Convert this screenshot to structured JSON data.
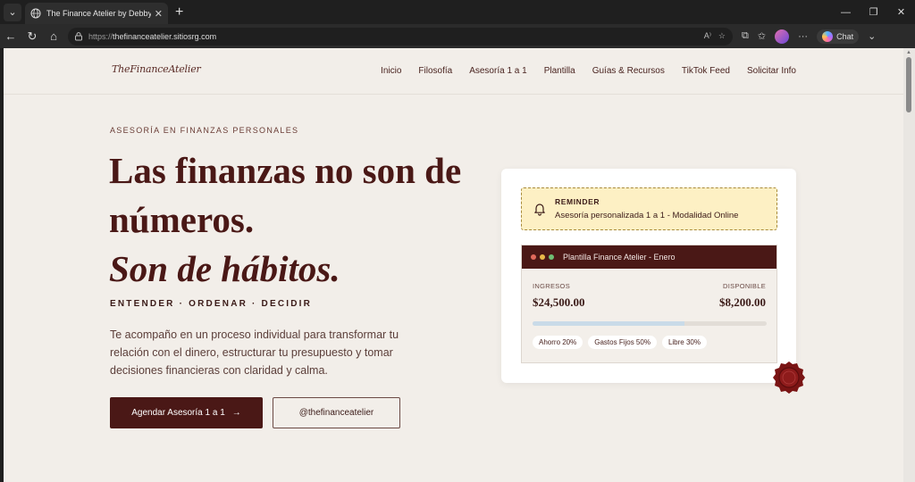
{
  "browser": {
    "tab_title": "The Finance Atelier by Debby Rive",
    "url_scheme": "https://",
    "url_host": "thefinanceatelier.sitiosrg.com",
    "copilot_label": "Chat"
  },
  "site": {
    "logo": "TheFinanceAtelier",
    "nav": [
      "Inicio",
      "Filosofía",
      "Asesoría 1 a 1",
      "Plantilla",
      "Guías & Recursos",
      "TikTok Feed",
      "Solicitar Info"
    ]
  },
  "hero": {
    "eyebrow": "ASESORÍA EN FINANZAS PERSONALES",
    "title_line1": "Las finanzas no son de",
    "title_line2": "números.",
    "title_line3": "Son de hábitos.",
    "tagline": "ENTENDER · ORDENAR · DECIDIR",
    "paragraph": "Te acompaño en un proceso individual para transformar tu relación con el dinero, estructurar tu presupuesto y tomar decisiones financieras con claridad y calma.",
    "cta_primary": "Agendar Asesoría 1 a 1",
    "cta_secondary": "@thefinanceatelier"
  },
  "card": {
    "reminder_title": "REMINDER",
    "reminder_text": "Asesoría personalizada 1 a 1 - Modalidad Online",
    "sheet_title": "Plantilla Finance Atelier - Enero",
    "income_label": "INGRESOS",
    "income_value": "$24,500.00",
    "available_label": "DISPONIBLE",
    "available_value": "$8,200.00",
    "progress_fraction": 0.65,
    "chips": [
      "Ahorro 20%",
      "Gastos Fijos 50%",
      "Libre 30%"
    ]
  },
  "colors": {
    "brand_dark": "#4a1816",
    "background": "#f2eee9",
    "reminder_bg": "#fdf0c4",
    "dot_red": "#e06a5c",
    "dot_yellow": "#e9b949",
    "dot_green": "#6fbf73"
  }
}
